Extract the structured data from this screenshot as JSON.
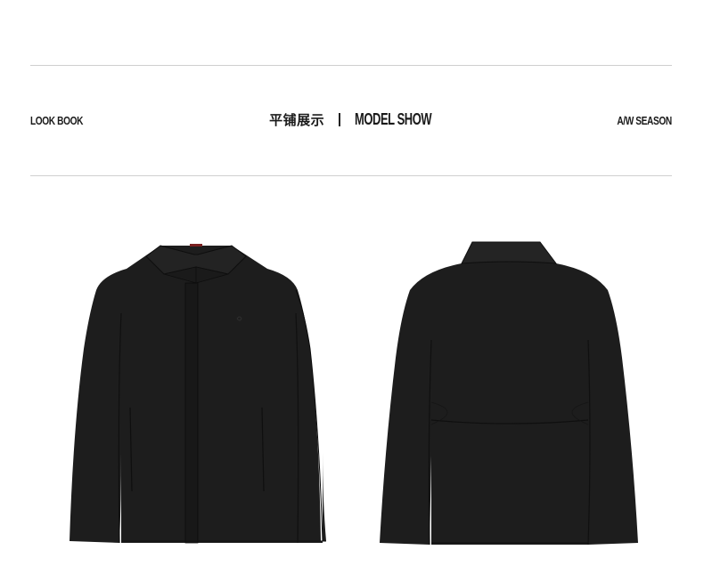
{
  "header": {
    "left_label": "LOOK BOOK",
    "center_cn": "平铺展示",
    "center_en": "MODEL SHOW",
    "right_label": "A/W SEASON"
  },
  "images": {
    "front": "jacket-front-view",
    "back": "jacket-back-view"
  },
  "colors": {
    "garment": "#1c1c1c",
    "rule": "#cfcfcf",
    "text": "#1a1a1a"
  }
}
